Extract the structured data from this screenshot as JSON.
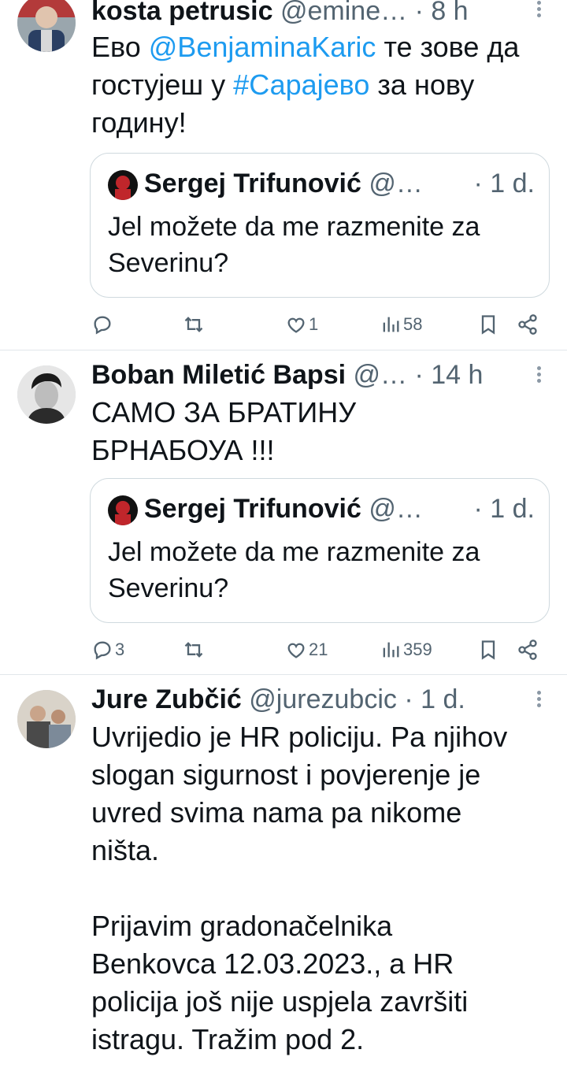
{
  "tweets": [
    {
      "name": "kosta petrusic",
      "handle": "@emine…",
      "time": "· 8 h",
      "text_parts": [
        "Ево ",
        "@BenjaminaKaric",
        " те зове да\nгостујеш у ",
        "#Сарајево",
        " за нову\nгодину!"
      ],
      "quote": {
        "name": "Sergej Trifunović",
        "handle": "@…",
        "time": "· 1 d.",
        "text": "Jel možete da me razmenite za\nSeverinu?"
      },
      "actions": {
        "replies": "",
        "retweets": "",
        "likes": "1",
        "views": "58"
      }
    },
    {
      "name": "Boban Miletić Bapsi",
      "handle": "@…",
      "time": "· 14 h",
      "text": "САМО ЗА БРАТИНУ\nБРНАБОУА !!!",
      "quote": {
        "name": "Sergej Trifunović",
        "handle": "@…",
        "time": "· 1 d.",
        "text": "Jel možete da me razmenite za\nSeverinu?"
      },
      "actions": {
        "replies": "3",
        "retweets": "",
        "likes": "21",
        "views": "359"
      }
    },
    {
      "name": "Jure Zubčić",
      "handle": "@jurezubcic",
      "time": "· 1 d.",
      "text": "Uvrijedio je HR policiju. Pa njihov\nslogan sigurnost i povjerenje je\nuvred svima nama pa nikome\nništa.\n\nPrijavim gradonačelnika\nBenkovca 12.03.2023., a HR\npolicija još nije uspjela završiti\nistragu. Tražim pod 2."
    }
  ],
  "icons": {
    "reply": "reply-icon",
    "retweet": "retweet-icon",
    "like": "heart-icon",
    "views": "views-icon",
    "bookmark": "bookmark-icon",
    "share": "share-icon",
    "more": "more-icon"
  },
  "colors": {
    "link": "#1d9bf0",
    "muted": "#536471",
    "border": "#cfd9de"
  }
}
